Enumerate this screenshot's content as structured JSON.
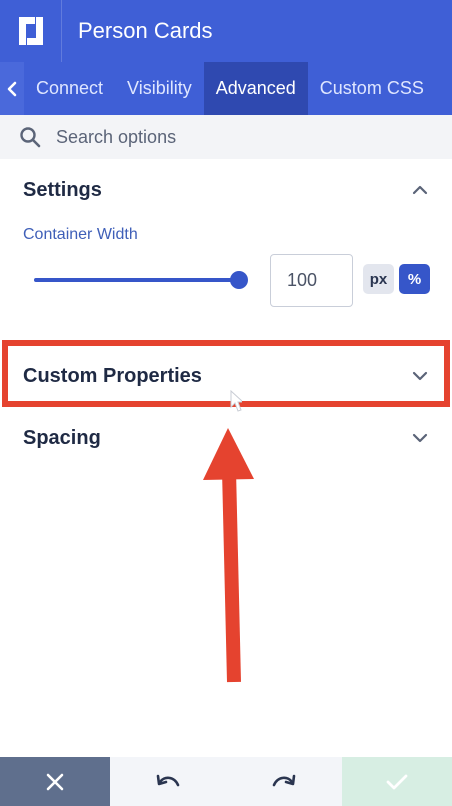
{
  "app": {
    "title": "Person Cards",
    "brand_color": "#3f5fd6"
  },
  "tabs": {
    "back_icon": "chevron-left-icon",
    "items": [
      {
        "label": "Connect",
        "active": false
      },
      {
        "label": "Visibility",
        "active": false
      },
      {
        "label": "Advanced",
        "active": true
      },
      {
        "label": "Custom CSS",
        "active": false
      }
    ]
  },
  "search": {
    "placeholder": "Search options",
    "icon": "search-icon"
  },
  "settings": {
    "title": "Settings",
    "expanded": true,
    "container_width": {
      "label": "Container Width",
      "value": "100",
      "slider_fraction": 1.0,
      "units": {
        "px": "px",
        "percent": "%"
      },
      "selected_unit": "%"
    }
  },
  "custom_properties": {
    "title": "Custom Properties",
    "expanded": false,
    "highlight_color": "#e5432f"
  },
  "spacing": {
    "title": "Spacing",
    "expanded": false
  },
  "footer": {
    "close_icon": "close-icon",
    "undo_icon": "undo-icon",
    "redo_icon": "redo-icon",
    "confirm_icon": "check-icon"
  }
}
